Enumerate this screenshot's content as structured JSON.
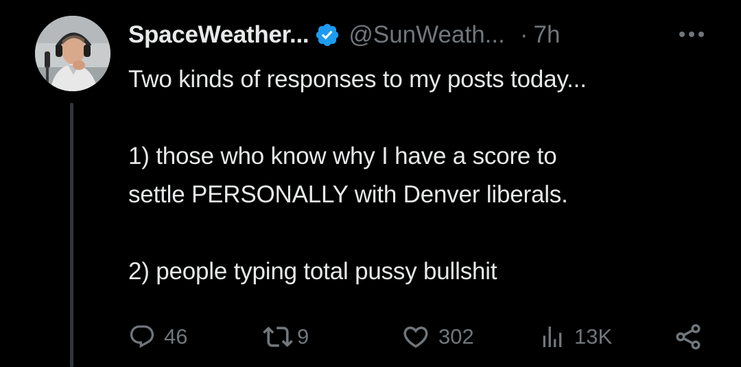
{
  "tweet": {
    "display_name": "SpaceWeather...",
    "handle": "@SunWeath...",
    "separator": "·",
    "time": "7h",
    "lines": [
      "Two kinds of responses to my posts today...",
      "",
      "1) those who know why I have a score to",
      "settle PERSONALLY with Denver liberals.",
      "",
      "2) people typing total pussy bullshit"
    ]
  },
  "actions": {
    "replies": "46",
    "reposts": "9",
    "likes": "302",
    "views": "13K"
  },
  "icons": {
    "verified": "verified-badge-icon",
    "more": "more-horizontal-icon",
    "reply": "reply-bubble-icon",
    "repost": "repost-arrows-icon",
    "like": "heart-icon",
    "views": "bar-chart-icon",
    "share": "share-icon"
  },
  "colors": {
    "background": "#000000",
    "text_primary": "#e7e9ea",
    "text_secondary": "#71767b",
    "verified_blue": "#1d9bf0",
    "thread_line": "#333639"
  }
}
